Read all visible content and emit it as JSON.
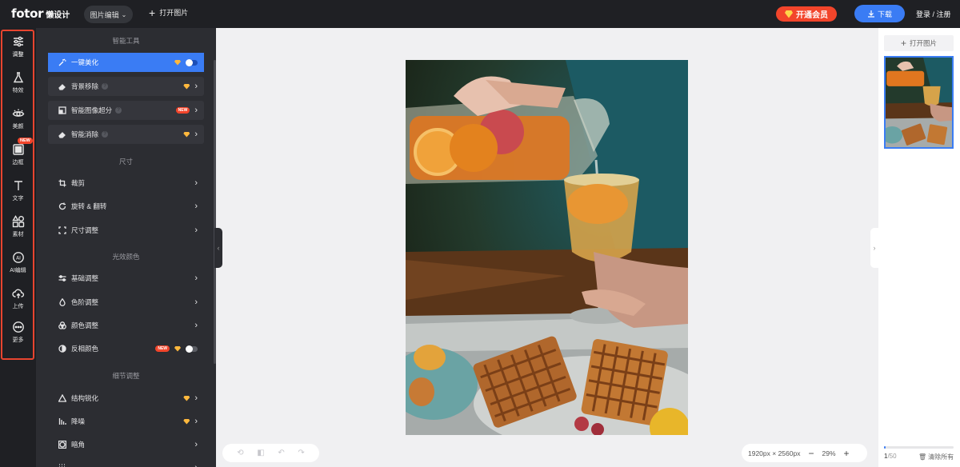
{
  "topbar": {
    "logo_main": "fotor",
    "logo_sub": "懒设计",
    "mode_label": "图片编辑",
    "open_image_label": "打开图片",
    "vip_label": "开通会员",
    "download_label": "下载",
    "login_label": "登录 / 注册"
  },
  "rail": {
    "items": [
      {
        "label": "调整",
        "icon": "sliders-icon",
        "active": true
      },
      {
        "label": "特效",
        "icon": "flask-icon"
      },
      {
        "label": "美颜",
        "icon": "eye-icon"
      },
      {
        "label": "边框",
        "icon": "frame-icon",
        "badge": "NEW"
      },
      {
        "label": "文字",
        "icon": "text-icon"
      },
      {
        "label": "素材",
        "icon": "shapes-icon"
      },
      {
        "label": "AI编辑",
        "icon": "ai-icon"
      },
      {
        "label": "上传",
        "icon": "upload-cloud-icon"
      },
      {
        "label": "更多",
        "icon": "more-icon"
      }
    ]
  },
  "panel": {
    "sections": {
      "smart": "智能工具",
      "size": "尺寸",
      "light": "光效颜色",
      "detail": "细节调整"
    },
    "tools": {
      "one_click": "一键美化",
      "bg_remove": "背景移除",
      "super_res": "智能图像超分",
      "smart_erase": "智能消除",
      "crop": "裁剪",
      "rotate": "旋转 & 翻转",
      "resize": "尺寸调整",
      "basic": "基础调整",
      "levels": "色阶调整",
      "color": "颜色调整",
      "invert": "反相颜色",
      "sharpen": "结构锐化",
      "denoise": "降噪",
      "vignette": "暗角"
    },
    "new_badge": "NEW"
  },
  "canvas": {
    "dimensions": "1920px × 2560px",
    "zoom": "29%"
  },
  "right_panel": {
    "open_image_label": "打开图片",
    "count_current": "1",
    "count_total": "/50",
    "progress": 0.02,
    "clear_label": "清除所有"
  },
  "colors": {
    "accent": "#3a7cf4",
    "vip": "#f2452b",
    "dark_bg": "#1f2024",
    "panel_bg": "#2c2d32"
  }
}
